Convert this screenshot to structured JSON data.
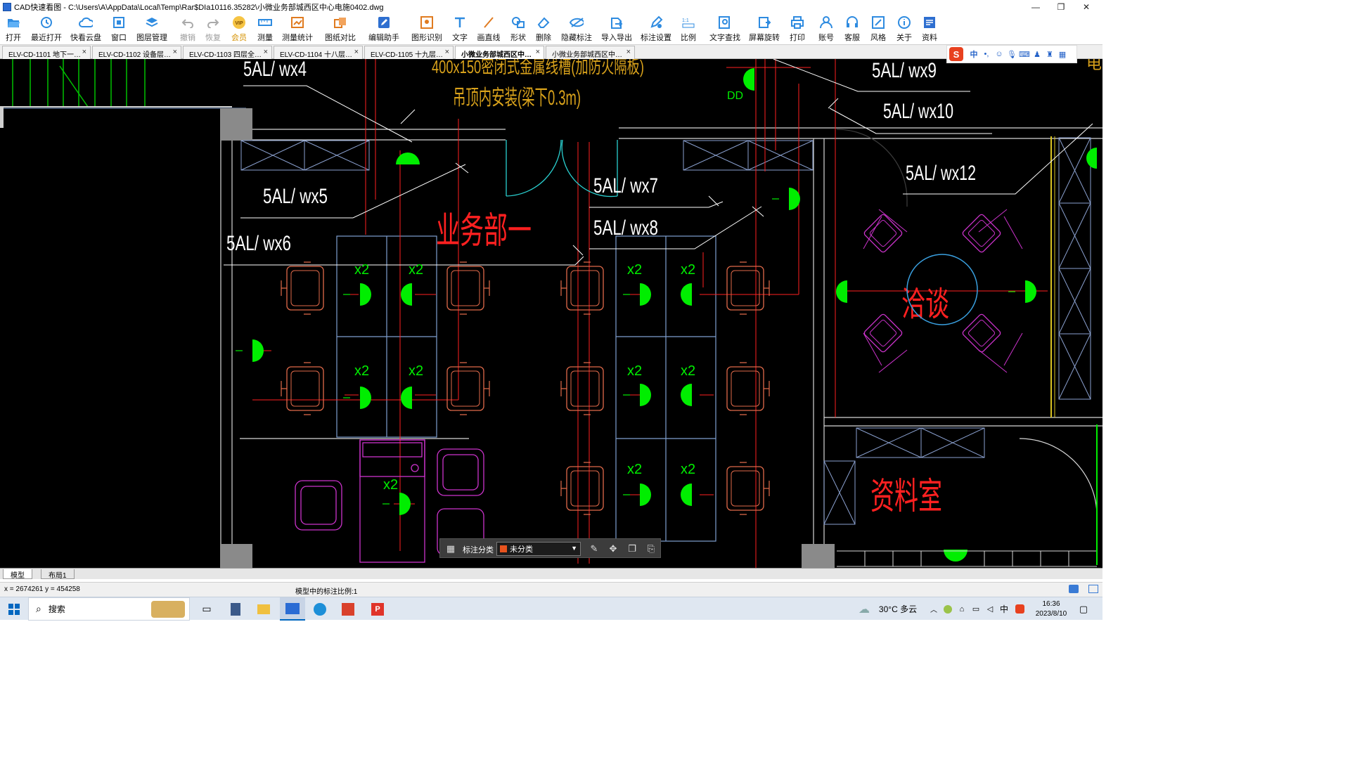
{
  "window": {
    "title": "CAD快速看图 - C:\\Users\\A\\AppData\\Local\\Temp\\Rar$DIa10116.35282\\小微业务部城西区中心电施0402.dwg",
    "minimize": "—",
    "maximize": "❐",
    "close": "✕"
  },
  "toolbar": {
    "open": "打开",
    "recent": "最近打开",
    "cloud": "快看云盘",
    "window": "窗口",
    "layers": "图层管理",
    "undo": "撤销",
    "redo": "恢复",
    "vip": "会员",
    "measure": "测量",
    "measure_stats": "测量统计",
    "compare": "图纸对比",
    "edit_assist": "编辑助手",
    "shape_recog": "图形识别",
    "text": "文字",
    "line": "画直线",
    "shape": "形状",
    "delete": "删除",
    "hide_marks": "隐藏标注",
    "import_export": "导入导出",
    "mark_settings": "标注设置",
    "scale": "比例",
    "text_search": "文字查找",
    "rotate": "屏幕旋转",
    "print": "打印",
    "account": "账号",
    "service": "客服",
    "style": "风格",
    "about": "关于",
    "resources": "资料",
    "vip_badge": "VIP"
  },
  "tabs": [
    {
      "label": "ELV-CD-1101 地下一…"
    },
    {
      "label": "ELV-CD-1102 设备层…"
    },
    {
      "label": "ELV-CD-1103 四层全…"
    },
    {
      "label": "ELV-CD-1104 十八层…"
    },
    {
      "label": "ELV-CD-1105 十九层…"
    },
    {
      "label": "小微业务部城西区中…"
    },
    {
      "label": "小微业务部城西区中…"
    }
  ],
  "ime": {
    "logo": "S",
    "mode": "中"
  },
  "drawing": {
    "labels": {
      "wx4": "5AL/ wx4",
      "wx5": "5AL/ wx5",
      "wx6": "5AL/ wx6",
      "wx7": "5AL/ wx7",
      "wx8": "5AL/ wx8",
      "wx9": "5AL/ wx9",
      "wx10": "5AL/ wx10",
      "wx12": "5AL/ wx12",
      "tray": "400x150密闭式金属线槽(加防火隔板)",
      "ceiling": "吊顶内安装(梁下0.3m)",
      "dept": "业务部一",
      "meeting": "洽谈",
      "archive": "资料室",
      "x2": "x2",
      "dd": "DD",
      "elec": "电"
    }
  },
  "floatbar": {
    "label": "标注分类",
    "selected": "未分类",
    "arrow": "▼"
  },
  "layout_tabs": {
    "model": "模型",
    "layout1": "布局1"
  },
  "status": {
    "coords": "x = 2674261  y = 454258",
    "scale": "模型中的标注比例:1"
  },
  "taskbar": {
    "search": "搜索",
    "weather": "30°C 多云",
    "lang": "中",
    "time": "16:36",
    "date": "2023/8/10"
  },
  "colors": {
    "canvas_bg": "#000000",
    "annotation": "#ffffff",
    "red_text": "#ff2020",
    "orange_text": "#d9a21b",
    "socket": "#00ff00",
    "furniture_magenta": "#cc33cc",
    "chairs": "#e06a4a",
    "walls_blue": "#7f9fd0"
  }
}
